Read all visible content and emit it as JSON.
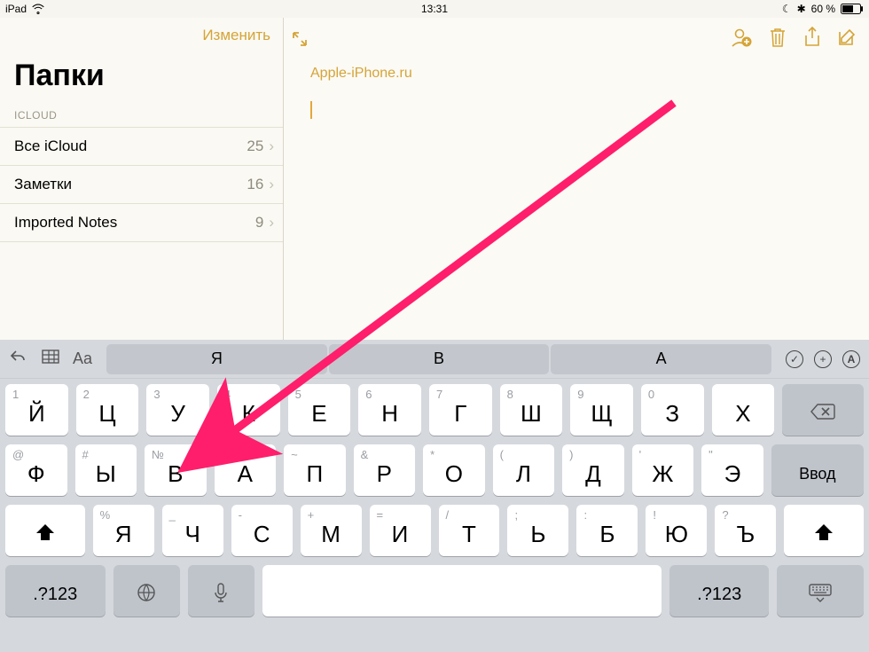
{
  "status": {
    "device": "iPad",
    "time": "13:31",
    "battery_text": "60 %",
    "dnd": "☾",
    "bt": "✱"
  },
  "sidebar": {
    "edit": "Изменить",
    "title": "Папки",
    "section": "ICLOUD",
    "items": [
      {
        "label": "Все iCloud",
        "count": "25"
      },
      {
        "label": "Заметки",
        "count": "16"
      },
      {
        "label": "Imported Notes",
        "count": "9"
      }
    ]
  },
  "note": {
    "link": "Apple-iPhone.ru"
  },
  "keyboard": {
    "suggestions": [
      "Я",
      "В",
      "А"
    ],
    "row1": [
      {
        "c": "Й",
        "h": "1"
      },
      {
        "c": "Ц",
        "h": "2"
      },
      {
        "c": "У",
        "h": "3"
      },
      {
        "c": "К",
        "h": "4"
      },
      {
        "c": "Е",
        "h": "5"
      },
      {
        "c": "Н",
        "h": "6"
      },
      {
        "c": "Г",
        "h": "7"
      },
      {
        "c": "Ш",
        "h": "8"
      },
      {
        "c": "Щ",
        "h": "9"
      },
      {
        "c": "З",
        "h": "0"
      },
      {
        "c": "Х",
        "h": ""
      }
    ],
    "row2": [
      {
        "c": "Ф",
        "h": "@"
      },
      {
        "c": "Ы",
        "h": "#"
      },
      {
        "c": "В",
        "h": "№"
      },
      {
        "c": "А",
        "h": "₽"
      },
      {
        "c": "П",
        "h": "~"
      },
      {
        "c": "Р",
        "h": "&"
      },
      {
        "c": "О",
        "h": "*"
      },
      {
        "c": "Л",
        "h": "("
      },
      {
        "c": "Д",
        "h": ")"
      },
      {
        "c": "Ж",
        "h": "'"
      },
      {
        "c": "Э",
        "h": "\""
      }
    ],
    "enter": "Ввод",
    "row3": [
      {
        "c": "Я",
        "h": "%"
      },
      {
        "c": "Ч",
        "h": "_"
      },
      {
        "c": "С",
        "h": "-"
      },
      {
        "c": "М",
        "h": "+"
      },
      {
        "c": "И",
        "h": "="
      },
      {
        "c": "Т",
        "h": "/"
      },
      {
        "c": "Ь",
        "h": ";"
      },
      {
        "c": "Б",
        "h": ":"
      },
      {
        "c": "Ю",
        "h": "!"
      },
      {
        "c": "Ъ",
        "h": "?"
      }
    ],
    "numkey": ".?123"
  }
}
